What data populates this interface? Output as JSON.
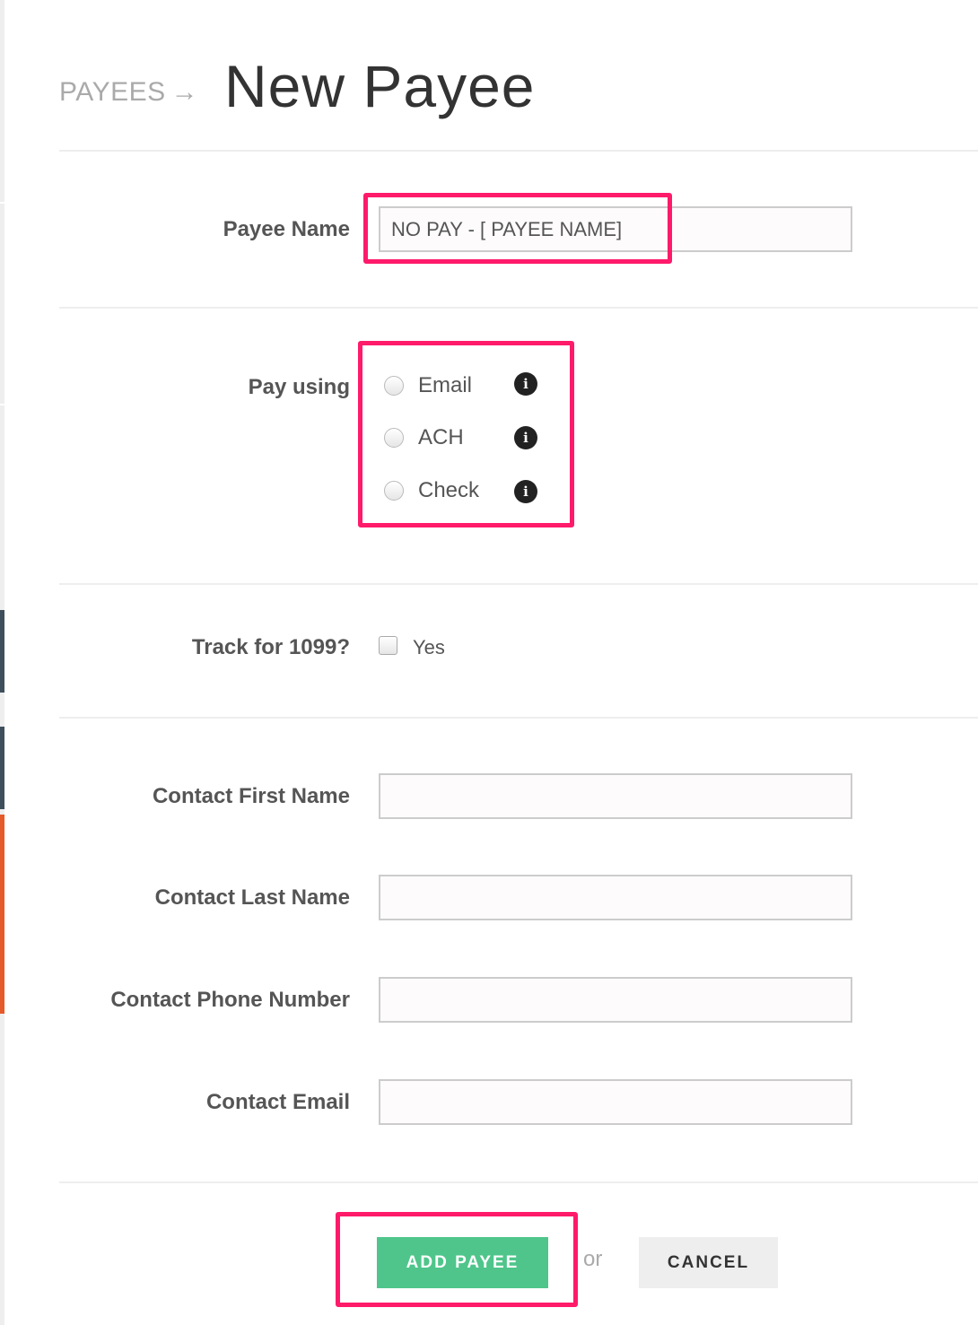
{
  "breadcrumb": {
    "parent": "PAYEES",
    "arrow": "→"
  },
  "page_title": "New Payee",
  "payee_name": {
    "label": "Payee Name",
    "value": "NO PAY - [ PAYEE NAME]"
  },
  "pay_using": {
    "label": "Pay using",
    "options": [
      {
        "label": "Email",
        "icon": "info-icon",
        "selected": false
      },
      {
        "label": "ACH",
        "icon": "info-icon",
        "selected": false
      },
      {
        "label": "Check",
        "icon": "info-icon",
        "selected": false
      }
    ],
    "info_glyph": "i"
  },
  "track_1099": {
    "label": "Track for 1099?",
    "option_label": "Yes",
    "checked": false
  },
  "contact": {
    "first_name_label": "Contact First Name",
    "last_name_label": "Contact Last Name",
    "phone_label": "Contact Phone Number",
    "email_label": "Contact Email",
    "first_name_value": "",
    "last_name_value": "",
    "phone_value": "",
    "email_value": ""
  },
  "actions": {
    "add_label": "ADD PAYEE",
    "or_text": "or",
    "cancel_label": "CANCEL"
  },
  "colors": {
    "highlight": "#ff1a6a",
    "add_button": "#4fc58b",
    "sidebar_dark": "#3e4f5b",
    "sidebar_orange": "#e55a2b"
  }
}
